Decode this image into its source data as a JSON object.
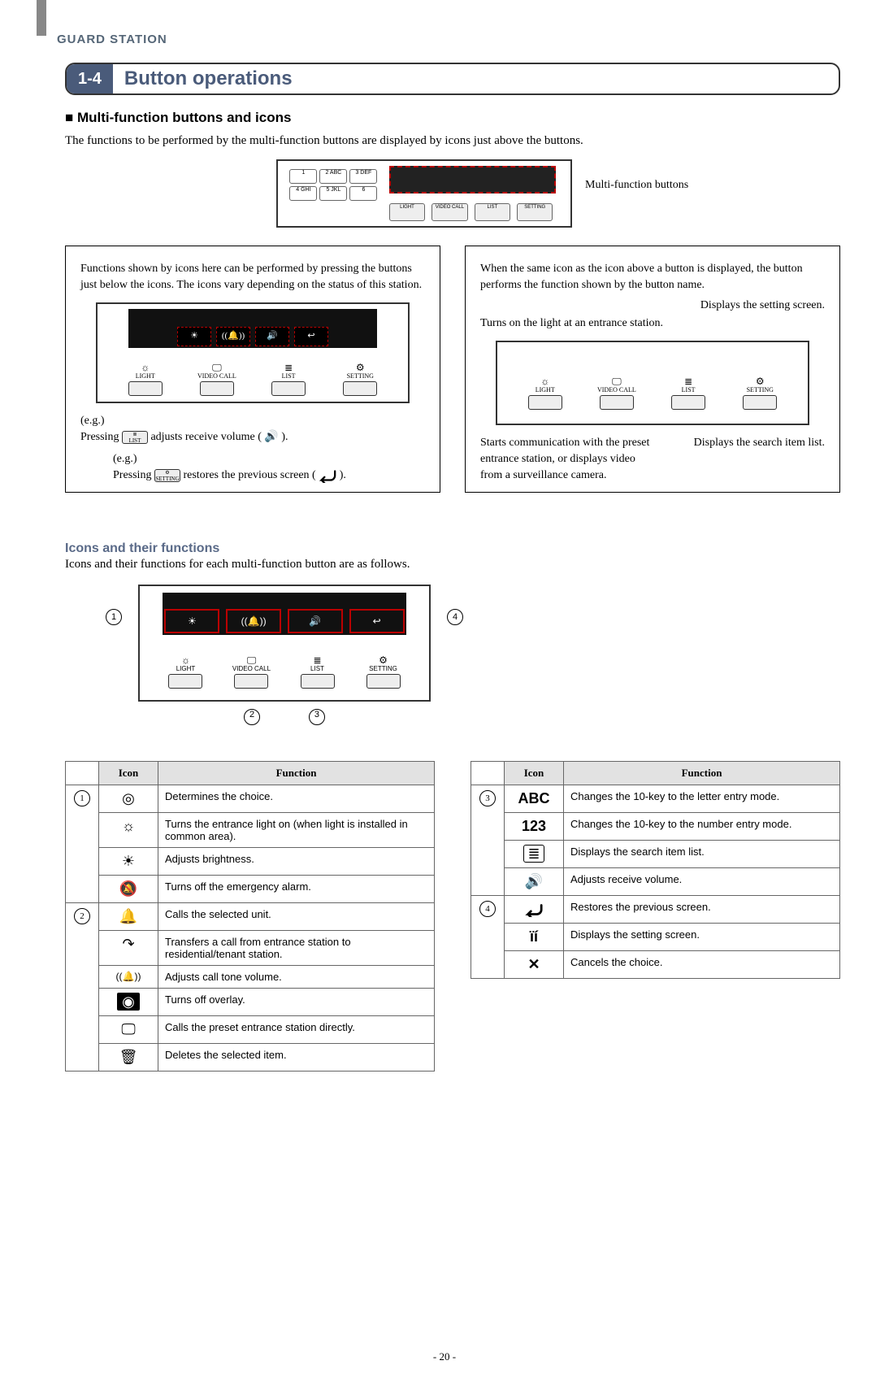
{
  "header": "GUARD STATION",
  "section": {
    "num": "1-4",
    "title": "Button operations"
  },
  "sub_heading": "■ Multi-function buttons and icons",
  "intro": "The functions to be performed by the multi-function buttons are displayed by icons just above the buttons.",
  "mfb_label": "Multi-function buttons",
  "left_box": {
    "desc": "Functions shown by icons here can be performed by pressing the buttons just below the icons. The icons vary depending on the status of this station.",
    "eg1_prefix": "(e.g.)",
    "eg1_a": "Pressing ",
    "eg1_key_label": "LIST",
    "eg1_b": " adjusts receive volume ( ",
    "eg1_icon": "🔊",
    "eg1_c": " ).",
    "eg2_prefix": "(e.g.)",
    "eg2_a": "Pressing ",
    "eg2_key_label": "SETTING",
    "eg2_b": " restores the previous screen ( ",
    "eg2_icon": "↩",
    "eg2_c": " )."
  },
  "right_box": {
    "desc": "When the same icon as the icon above a button is displayed, the button performs the function shown by the button name.",
    "a_setting": "Displays the setting screen.",
    "a_light": "Turns on the light at an entrance station.",
    "a_video": "Starts communication with the preset entrance station, or displays video from a surveillance camera.",
    "a_list": "Displays the search item list."
  },
  "buttons": {
    "light": "LIGHT",
    "video": "VIDEO CALL",
    "list": "LIST",
    "setting": "SETTING"
  },
  "keypad": [
    "1",
    "2 ABC",
    "3 DEF",
    "4 GHI",
    "5 JKL",
    "6"
  ],
  "icons_section": {
    "heading": "Icons and their functions",
    "sub": "Icons and their functions for each multi-function button are as follows."
  },
  "circled": {
    "1": "1",
    "2": "2",
    "3": "3",
    "4": "4"
  },
  "table_headers": {
    "icon": "Icon",
    "func": "Function"
  },
  "table_left": {
    "g1": {
      "num": "1",
      "rows": [
        {
          "icon": "◎",
          "text": "Determines the choice."
        },
        {
          "icon": "☼",
          "text": "Turns the entrance light on (when light is installed in common area)."
        },
        {
          "icon": "☀",
          "text": "Adjusts brightness."
        },
        {
          "icon": "🔕",
          "text": "Turns off the emergency alarm."
        }
      ]
    },
    "g2": {
      "num": "2",
      "rows": [
        {
          "icon": "🔔",
          "text": "Calls the selected unit."
        },
        {
          "icon": "↷",
          "text": "Transfers a call from entrance station to residential/tenant station."
        },
        {
          "icon": "((🔔))",
          "text": "Adjusts call tone volume."
        },
        {
          "icon": "◉",
          "text": "Turns off overlay."
        },
        {
          "icon": "🖵",
          "text": "Calls the preset entrance station directly."
        },
        {
          "icon": "🗑",
          "text": "Deletes the selected item."
        }
      ]
    }
  },
  "table_right": {
    "g3": {
      "num": "3",
      "rows": [
        {
          "icon": "ABC",
          "text": "Changes the 10-key to the letter entry mode."
        },
        {
          "icon": "123",
          "text": "Changes the 10-key to the number entry mode."
        },
        {
          "icon": "≣",
          "text": "Displays the search item list."
        },
        {
          "icon": "🔊",
          "text": "Adjusts receive volume."
        }
      ]
    },
    "g4": {
      "num": "4",
      "rows": [
        {
          "icon": "↩",
          "text": "Restores the previous screen."
        },
        {
          "icon": "⚙",
          "text": "Displays the setting screen."
        },
        {
          "icon": "✕",
          "text": "Cancels the choice."
        }
      ]
    }
  },
  "page_num": "- 20 -"
}
